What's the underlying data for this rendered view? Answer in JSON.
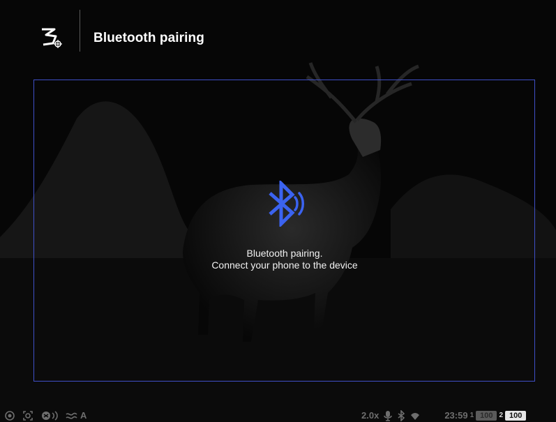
{
  "header": {
    "title": "Bluetooth pairing"
  },
  "pairing": {
    "line1": "Bluetooth pairing.",
    "line2": "Connect your phone to the device"
  },
  "statusbar": {
    "mode_letter": "A",
    "zoom": "2.0x",
    "time": "23:59",
    "battery1_label": "1",
    "battery1_value": "100",
    "battery2_label": "2",
    "battery2_value": "100"
  },
  "colors": {
    "accent": "#3b63f0",
    "frame": "#3f50c8",
    "background": "#050505"
  },
  "icons": [
    "logo-icon",
    "bluetooth-broadcast-icon",
    "record-icon",
    "photo-icon",
    "stream-icon",
    "wind-icon",
    "microphone-icon",
    "bluetooth-status-icon",
    "wifi-icon"
  ]
}
